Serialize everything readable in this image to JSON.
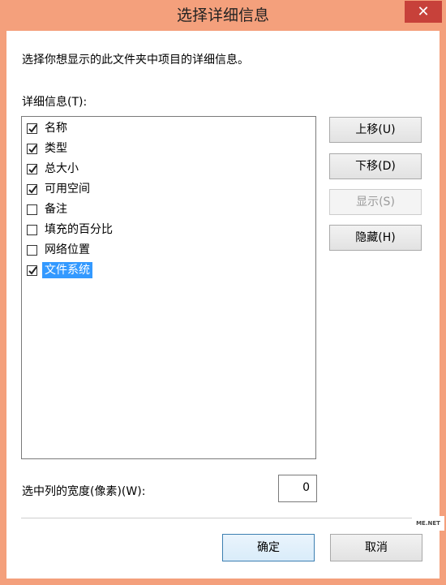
{
  "window": {
    "title": "选择详细信息",
    "close_glyph": "✕"
  },
  "dialog": {
    "description": "选择你想显示的此文件夹中项目的详细信息。",
    "list_label": "详细信息(T):",
    "items": [
      {
        "label": "名称",
        "checked": true,
        "selected": false
      },
      {
        "label": "类型",
        "checked": true,
        "selected": false
      },
      {
        "label": "总大小",
        "checked": true,
        "selected": false
      },
      {
        "label": "可用空间",
        "checked": true,
        "selected": false
      },
      {
        "label": "备注",
        "checked": false,
        "selected": false
      },
      {
        "label": "填充的百分比",
        "checked": false,
        "selected": false
      },
      {
        "label": "网络位置",
        "checked": false,
        "selected": false
      },
      {
        "label": "文件系统",
        "checked": true,
        "selected": true
      }
    ],
    "buttons": {
      "move_up": "上移(U)",
      "move_down": "下移(D)",
      "show": "显示(S)",
      "hide": "隐藏(H)",
      "ok": "确定",
      "cancel": "取消"
    },
    "width_label": "选中列的宽度(像素)(W):",
    "width_value": "0",
    "watermark": "ME.NET"
  },
  "colors": {
    "frame": "#f4a07c",
    "selection": "#3399ff",
    "close_button": "#c7413a"
  }
}
